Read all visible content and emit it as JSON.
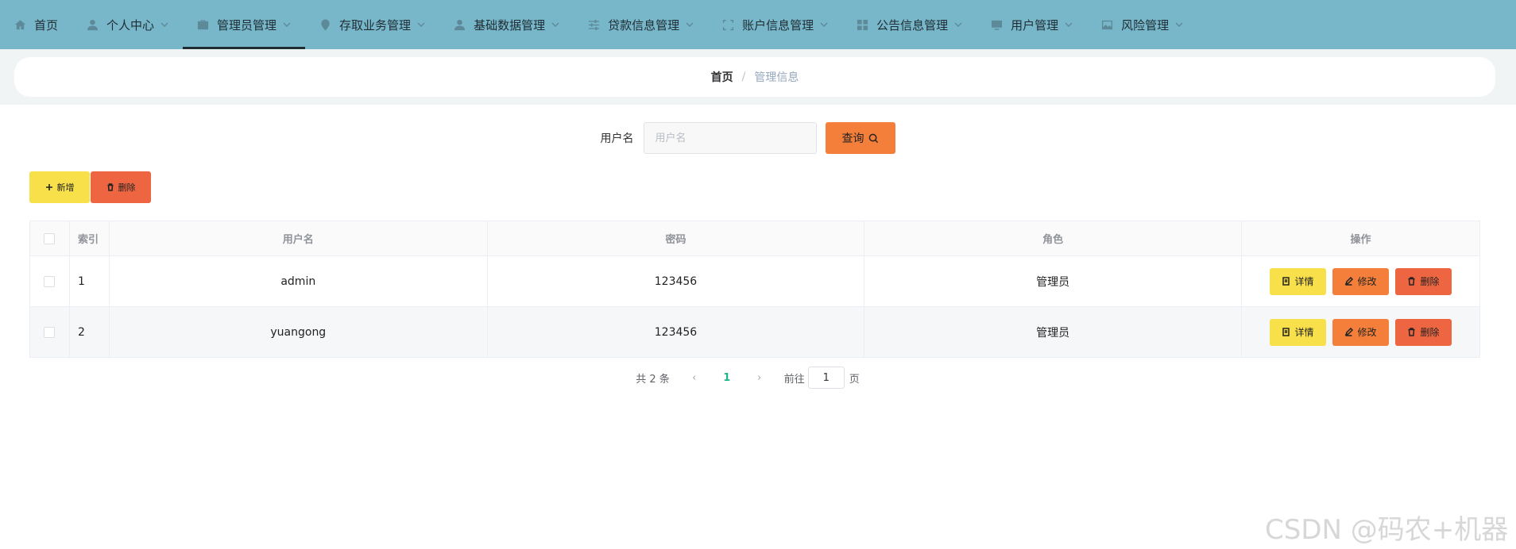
{
  "nav": {
    "items": [
      {
        "label": "首页",
        "icon": "home-icon",
        "dropdown": false,
        "active": false
      },
      {
        "label": "个人中心",
        "icon": "user-icon",
        "dropdown": true,
        "active": false
      },
      {
        "label": "管理员管理",
        "icon": "briefcase-icon",
        "dropdown": true,
        "active": true
      },
      {
        "label": "存取业务管理",
        "icon": "location-icon",
        "dropdown": true,
        "active": false
      },
      {
        "label": "基础数据管理",
        "icon": "user-icon",
        "dropdown": true,
        "active": false
      },
      {
        "label": "贷款信息管理",
        "icon": "sliders-icon",
        "dropdown": true,
        "active": false
      },
      {
        "label": "账户信息管理",
        "icon": "frame-icon",
        "dropdown": true,
        "active": false
      },
      {
        "label": "公告信息管理",
        "icon": "grid-icon",
        "dropdown": true,
        "active": false
      },
      {
        "label": "用户管理",
        "icon": "monitor-icon",
        "dropdown": true,
        "active": false
      },
      {
        "label": "风险管理",
        "icon": "image-icon",
        "dropdown": true,
        "active": false
      }
    ]
  },
  "breadcrumb": {
    "home": "首页",
    "separator": "/",
    "current": "管理信息"
  },
  "search": {
    "label": "用户名",
    "placeholder": "用户名",
    "value": "",
    "button_label": "查询"
  },
  "toolbar": {
    "add_label": "新增",
    "delete_label": "删除"
  },
  "table": {
    "headers": {
      "index": "索引",
      "username": "用户名",
      "password": "密码",
      "role": "角色",
      "operation": "操作"
    },
    "rows": [
      {
        "index": "1",
        "username": "admin",
        "password": "123456",
        "role": "管理员"
      },
      {
        "index": "2",
        "username": "yuangong",
        "password": "123456",
        "role": "管理员"
      }
    ],
    "op_labels": {
      "detail": "详情",
      "edit": "修改",
      "delete": "删除"
    }
  },
  "pagination": {
    "total_text": "共 2 条",
    "current_page": "1",
    "goto_label": "前往",
    "page_input": "1",
    "page_suffix": "页",
    "prev": "‹",
    "next": "›"
  },
  "watermark": "CSDN @码农+机器",
  "colors": {
    "nav_bg": "#78b6ca",
    "yellow": "#f8e04a",
    "orange": "#f47f3a",
    "red": "#ee6641",
    "page_active": "#21b38a"
  }
}
